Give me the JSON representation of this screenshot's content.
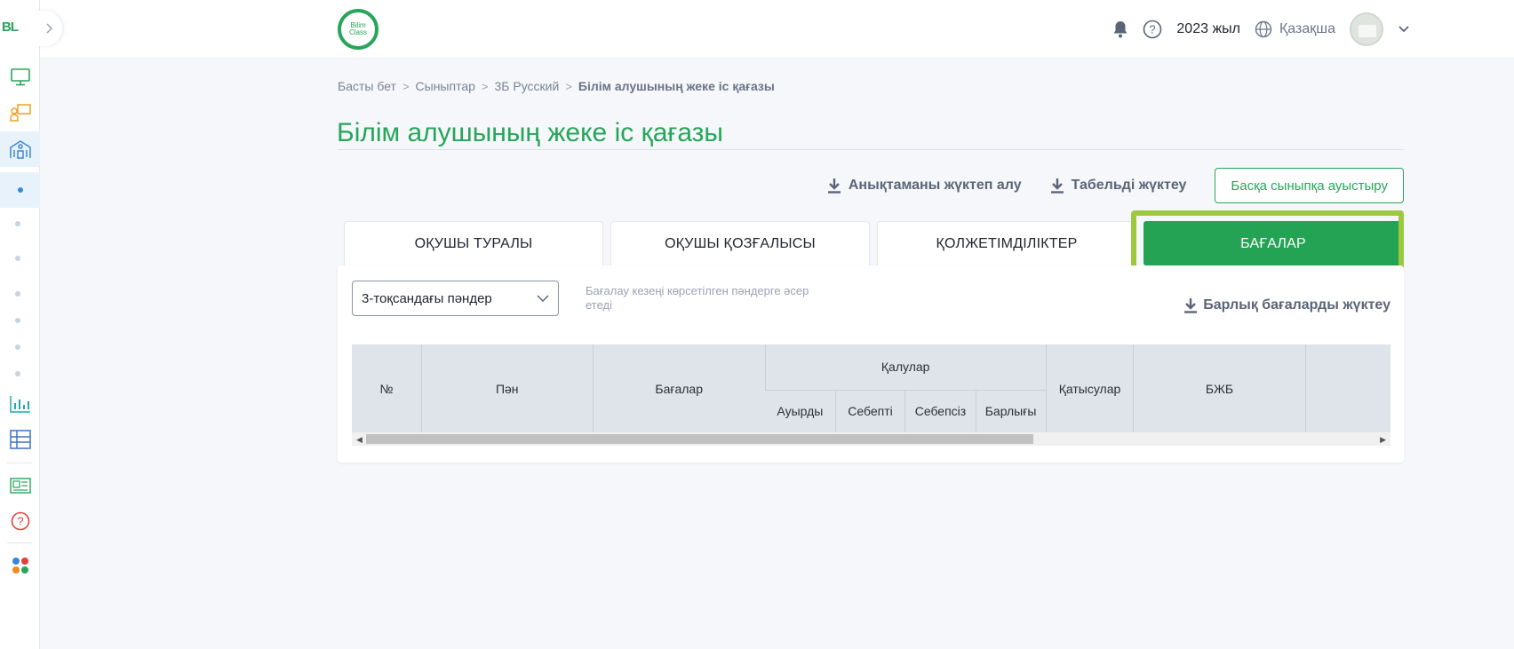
{
  "sidebar": {
    "logo": "BL",
    "items": [
      {
        "icon": "monitor-icon"
      },
      {
        "icon": "teacher-board-icon"
      },
      {
        "icon": "school-building-icon"
      },
      {
        "icon": "dot-active"
      },
      {
        "icon": "dot"
      },
      {
        "icon": "dot"
      },
      {
        "icon": "dot"
      },
      {
        "icon": "dot"
      },
      {
        "icon": "dot"
      },
      {
        "icon": "dot"
      },
      {
        "icon": "bar-chart-icon"
      },
      {
        "icon": "table-grid-icon"
      },
      {
        "icon": "id-card-icon"
      },
      {
        "icon": "help-circle-icon"
      },
      {
        "icon": "apps-dots-icon"
      }
    ]
  },
  "header": {
    "brand_line1": "Bilim",
    "brand_line2": "Class",
    "year": "2023 жыл",
    "language": "Қазақша"
  },
  "breadcrumb": [
    "Басты бет",
    "Сыныптар",
    "3Б Русский",
    "Білім алушының жеке іс қағазы"
  ],
  "page_title": "Білім алушының жеке іс қағазы",
  "actions": {
    "download_certificate": "Анықтаманы жүктеп алу",
    "download_tabel": "Табельді жүктеу",
    "switch_class": "Басқа сыныпқа ауыстыру"
  },
  "tabs": [
    {
      "label": "ОҚУШЫ ТУРАЛЫ",
      "active": false
    },
    {
      "label": "ОҚУШЫ ҚОЗҒАЛЫСЫ",
      "active": false
    },
    {
      "label": "ҚОЛЖЕТІМДІЛІКТЕР",
      "active": false
    },
    {
      "label": "БАҒАЛАР",
      "active": true
    }
  ],
  "filter": {
    "selected": "3-тоқсандағы пәндер",
    "hint": "Бағалау кезеңі көрсетілген пәндерге әсер етеді"
  },
  "download_all": "Барлық бағаларды жүктеу",
  "table": {
    "headers": {
      "num": "№",
      "subject": "Пән",
      "grades": "Бағалар",
      "absences": "Қалулар",
      "attendance": "Қатысулар",
      "bzb": "БЖБ"
    },
    "absence_sub": [
      "Ауырды",
      "Себепті",
      "Себепсіз",
      "Барлығы"
    ]
  },
  "colors": {
    "accent": "#27a55a",
    "active_tab": "#24a355",
    "highlight": "#9dc840"
  }
}
